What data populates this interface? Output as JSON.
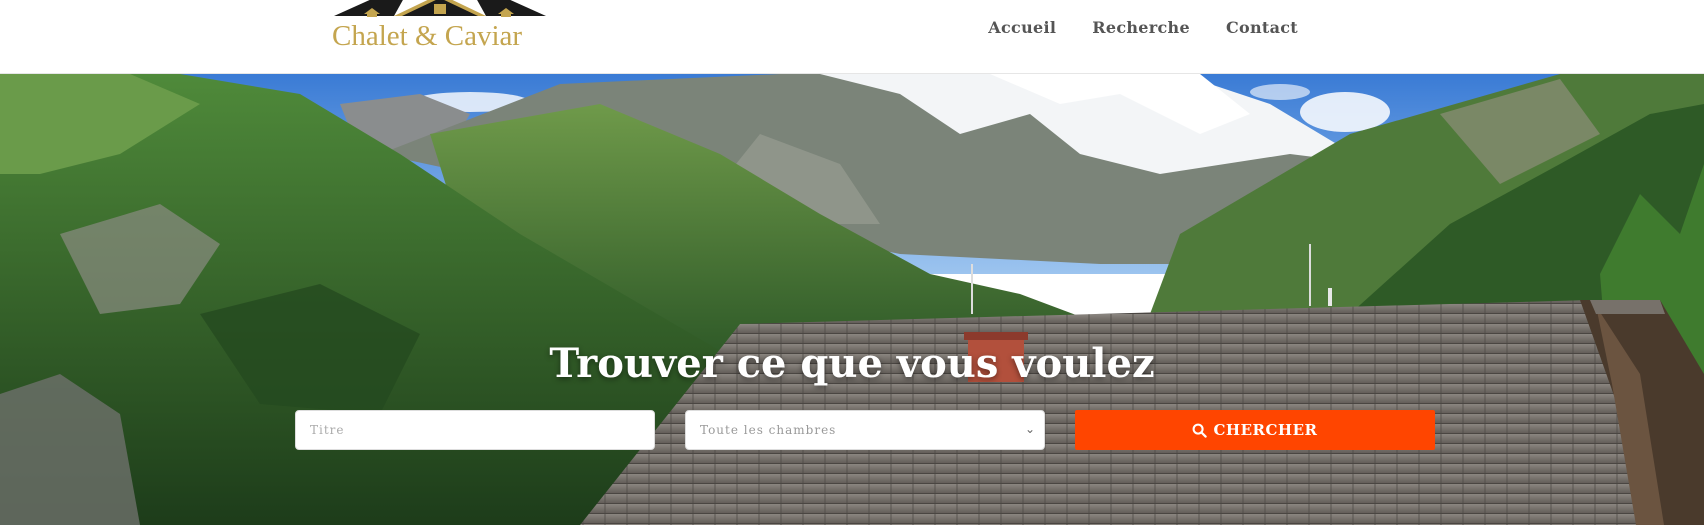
{
  "brand": {
    "name": "Chalet & Caviar"
  },
  "nav": {
    "items": [
      {
        "label": "Accueil"
      },
      {
        "label": "Recherche"
      },
      {
        "label": "Contact"
      }
    ]
  },
  "hero": {
    "title": "Trouver ce que vous voulez",
    "search": {
      "title_placeholder": "Titre",
      "rooms_selected": "Toute les chambres",
      "button_label": "CHERCHER",
      "button_icon": "search-icon"
    }
  },
  "colors": {
    "accent": "#ff4500",
    "brand_gold": "#c4a54f",
    "nav_text": "#555555"
  }
}
